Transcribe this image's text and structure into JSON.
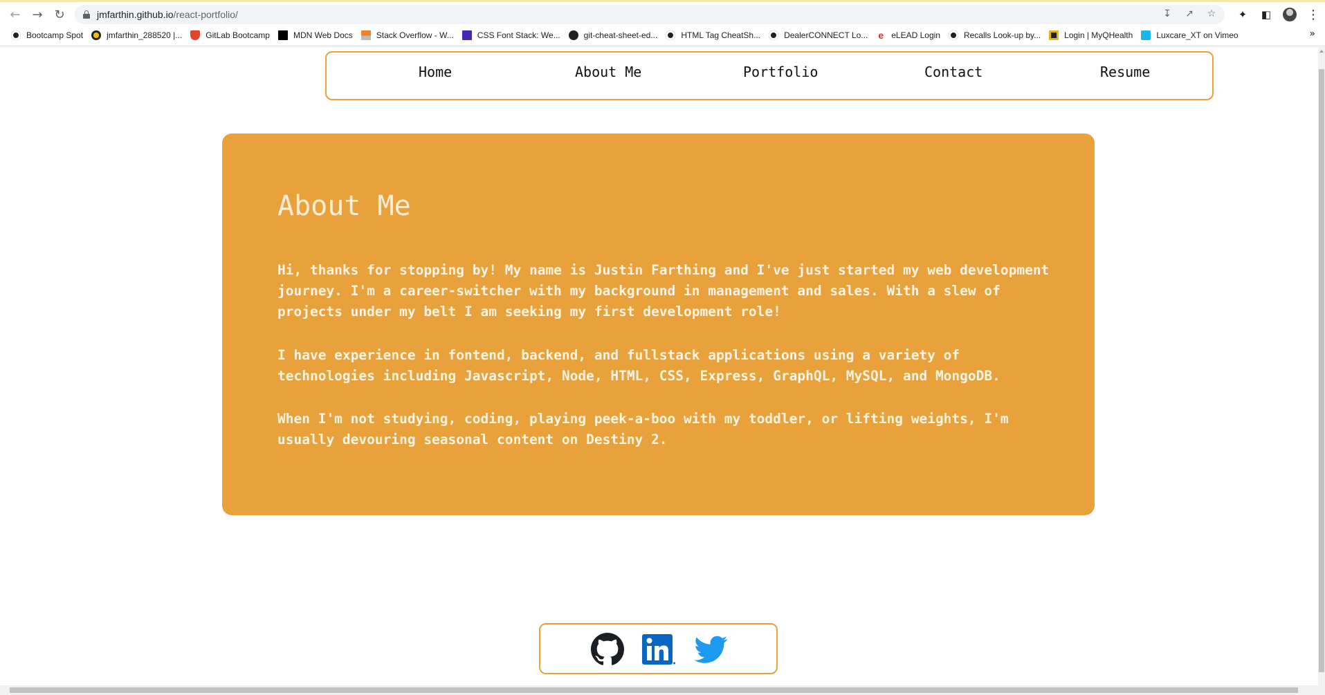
{
  "browser": {
    "url_host": "jmfarthin.github.io",
    "url_path": "/react-portfolio/",
    "bookmarks": [
      {
        "label": "Bootcamp Spot",
        "icon": "globe-icon"
      },
      {
        "label": "jmfarthin_288520 |...",
        "icon": "bee-icon"
      },
      {
        "label": "GitLab Bootcamp",
        "icon": "gitlab-icon"
      },
      {
        "label": "MDN Web Docs",
        "icon": "mdn-icon"
      },
      {
        "label": "Stack Overflow - W...",
        "icon": "stackoverflow-icon"
      },
      {
        "label": "CSS Font Stack: We...",
        "icon": "css-icon"
      },
      {
        "label": "git-cheat-sheet-ed...",
        "icon": "github-icon"
      },
      {
        "label": "HTML Tag CheatSh...",
        "icon": "globe-icon"
      },
      {
        "label": "DealerCONNECT Lo...",
        "icon": "globe-icon"
      },
      {
        "label": "eLEAD Login",
        "icon": "elead-icon"
      },
      {
        "label": "Recalls Look-up by...",
        "icon": "globe-icon"
      },
      {
        "label": "Login | MyQHealth",
        "icon": "myq-icon"
      },
      {
        "label": "Luxcare_XT on Vimeo",
        "icon": "vimeo-icon"
      }
    ]
  },
  "nav": {
    "items": [
      "Home",
      "About Me",
      "Portfolio",
      "Contact",
      "Resume"
    ]
  },
  "about": {
    "title": "About Me",
    "paragraphs": [
      "Hi, thanks for stopping by! My name is Justin Farthing and I've just started my web development journey. I'm a career-switcher with my background in management and sales. With a slew of projects under my belt I am seeking my first development role!",
      "I have experience in fontend, backend, and fullstack applications using a variety of technologies including Javascript, Node, HTML, CSS, Express, GraphQL, MySQL, and MongoDB.",
      "When I'm not studying, coding, playing peek-a-boo with my toddler, or lifting weights, I'm usually devouring seasonal content on Destiny 2."
    ]
  },
  "footer": {
    "social_icons": [
      "github-icon",
      "linkedin-icon",
      "twitter-icon"
    ]
  },
  "colors": {
    "accent": "#e9a13b",
    "card_text": "#fdf4e2",
    "linkedin": "#0a66c2",
    "twitter": "#1d9bf0"
  }
}
